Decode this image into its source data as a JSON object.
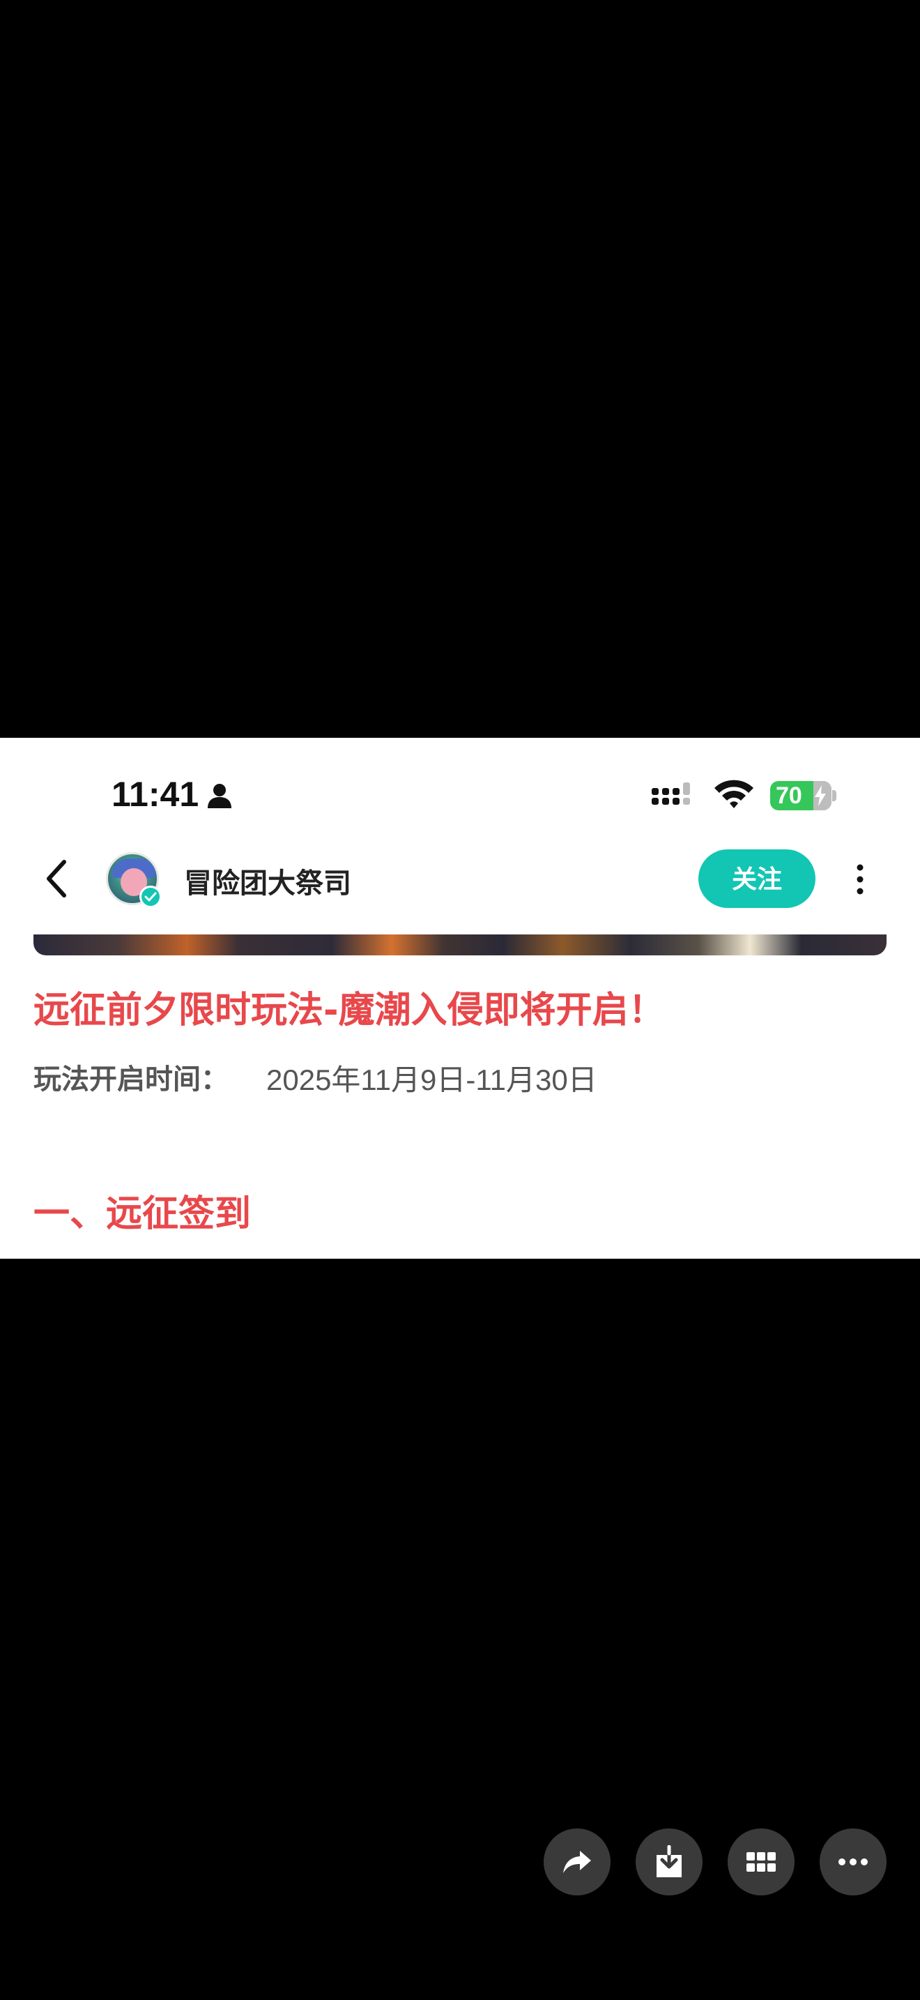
{
  "status_bar": {
    "time": "11:41",
    "battery": "70",
    "icons": [
      "person-icon",
      "signal-icon",
      "wifi-icon",
      "battery-charging-icon"
    ]
  },
  "nav": {
    "account_name": "冒险团大祭司",
    "follow_label": "关注",
    "icons": [
      "back-icon",
      "avatar",
      "verified-icon",
      "more-icon"
    ]
  },
  "article": {
    "title": "远征前夕限时玩法-魔潮入侵即将开启！",
    "schedule_label": "玩法开启时间：",
    "schedule_value": "2025年11月9日-11月30日",
    "section_heading": "一、远征签到"
  },
  "actions": {
    "icons": [
      "share-icon",
      "download-icon",
      "grid-icon",
      "more-options-icon"
    ]
  },
  "colors": {
    "accent_teal": "#12c6b3",
    "title_red": "#e8484b",
    "battery_green": "#35c759"
  }
}
